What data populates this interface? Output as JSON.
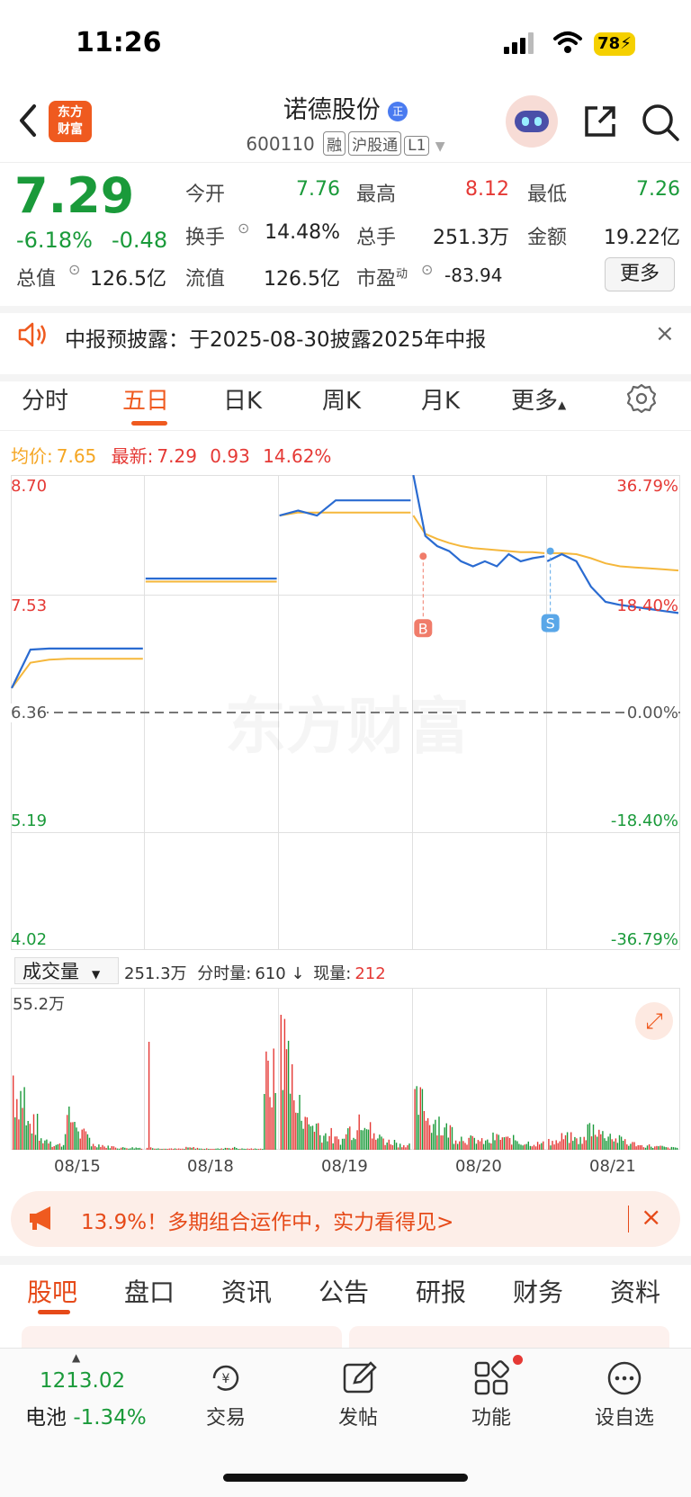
{
  "status": {
    "time": "11:26",
    "battery": "78"
  },
  "header": {
    "logo_line1": "东方",
    "logo_line2": "财富",
    "title": "诺德股份",
    "code": "600110",
    "tags": [
      "融",
      "沪股通",
      "L1"
    ]
  },
  "quote": {
    "price": "7.29",
    "change_pct": "-6.18%",
    "change": "-0.48",
    "open_label": "今开",
    "open": "7.76",
    "high_label": "最高",
    "high": "8.12",
    "low_label": "最低",
    "low": "7.26",
    "turnover_label": "换手",
    "turnover": "14.48%",
    "volume_label": "总手",
    "volume": "251.3万",
    "amount_label": "金额",
    "amount": "19.22亿",
    "mktcap_label": "总值",
    "mktcap": "126.5亿",
    "float_label": "流值",
    "float": "126.5亿",
    "pe_label": "市盈",
    "pe_sup": "动",
    "pe": "-83.94",
    "more_button": "更多"
  },
  "notice": {
    "text": "中报预披露：于2025-08-30披露2025年中报"
  },
  "chart_tabs": [
    "分时",
    "五日",
    "日K",
    "周K",
    "月K",
    "更多"
  ],
  "chart_info": {
    "avg_label": "均价:",
    "avg": "7.65",
    "latest_label": "最新:",
    "latest": "7.29",
    "change": "0.93",
    "change_pct": "14.62%"
  },
  "chart_data": {
    "type": "line",
    "y_ticks_left": [
      "8.70",
      "7.53",
      "6.36",
      "5.19",
      "4.02"
    ],
    "y_ticks_right": [
      "36.79%",
      "18.40%",
      "0.00%",
      "-18.40%",
      "-36.79%"
    ],
    "ylim": [
      4.02,
      8.7
    ],
    "prev_close": 6.36,
    "days": [
      "08/15",
      "08/18",
      "08/19",
      "08/20",
      "08/21"
    ],
    "series": [
      {
        "values_price": [
          [
            6.6,
            6.98,
            6.99,
            6.99,
            6.99,
            6.99,
            6.99,
            6.99
          ],
          [
            7.68,
            7.68,
            7.68,
            7.68,
            7.68,
            7.68,
            7.68,
            7.68
          ],
          [
            8.3,
            8.35,
            8.3,
            8.45,
            8.45,
            8.45,
            8.45,
            8.45
          ],
          [
            8.7,
            8.1,
            8.0,
            7.95,
            7.85,
            7.8,
            7.85,
            7.8,
            7.92,
            7.85,
            7.88,
            7.9
          ],
          [
            7.85,
            7.92,
            7.85,
            7.6,
            7.45,
            7.42,
            7.4,
            7.38,
            7.36,
            7.34
          ]
        ]
      },
      {
        "values_avg": [
          [
            6.6,
            6.85,
            6.88,
            6.89,
            6.89,
            6.89,
            6.89,
            6.89
          ],
          [
            7.65,
            7.65,
            7.65,
            7.65,
            7.65,
            7.65,
            7.65,
            7.65
          ],
          [
            8.3,
            8.33,
            8.33,
            8.33,
            8.33,
            8.33,
            8.33,
            8.33
          ],
          [
            8.3,
            8.12,
            8.07,
            8.03,
            8.0,
            7.98,
            7.97,
            7.96,
            7.95,
            7.94,
            7.94,
            7.93
          ],
          [
            7.93,
            7.93,
            7.92,
            7.88,
            7.83,
            7.8,
            7.79,
            7.78,
            7.77,
            7.76
          ]
        ]
      }
    ],
    "markers": [
      {
        "label": "B"
      },
      {
        "label": "S"
      }
    ]
  },
  "volume": {
    "dropdown": "成交量",
    "total": "251.3万",
    "tick_label": "分时量:",
    "tick_value": "610",
    "current_label": "现量:",
    "current_value": "212",
    "max_label": "55.2万"
  },
  "banner": {
    "text": "13.9%！多期组合运作中，实力看得见>"
  },
  "content_tabs": [
    "股吧",
    "盘口",
    "资讯",
    "公告",
    "研报",
    "财务",
    "资料"
  ],
  "bottom_nav": {
    "index_value": "1213.02",
    "index_name": "电池",
    "index_change": "-1.34%",
    "trade": "交易",
    "post": "发帖",
    "functions": "功能",
    "watchlist": "设自选"
  }
}
